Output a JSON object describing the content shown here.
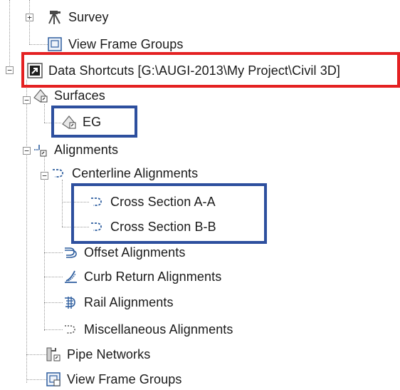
{
  "tree": {
    "survey": "Survey",
    "view_frame_groups_top": "View Frame Groups",
    "data_shortcuts": "Data Shortcuts [G:\\AUGI-2013\\My Project\\Civil 3D]",
    "surfaces": "Surfaces",
    "eg": "EG",
    "alignments": "Alignments",
    "centerline_alignments": "Centerline Alignments",
    "cross_section_aa": "Cross Section A-A",
    "cross_section_bb": "Cross Section B-B",
    "offset_alignments": "Offset Alignments",
    "curb_return_alignments": "Curb Return Alignments",
    "rail_alignments": "Rail Alignments",
    "misc_alignments": "Miscellaneous Alignments",
    "pipe_networks": "Pipe Networks",
    "view_frame_groups_bottom": "View Frame Groups"
  },
  "toggles": {
    "expand": "+",
    "collapse": "−"
  },
  "colors": {
    "red_box": "#e42122",
    "blue_box": "#2d4f9e"
  }
}
